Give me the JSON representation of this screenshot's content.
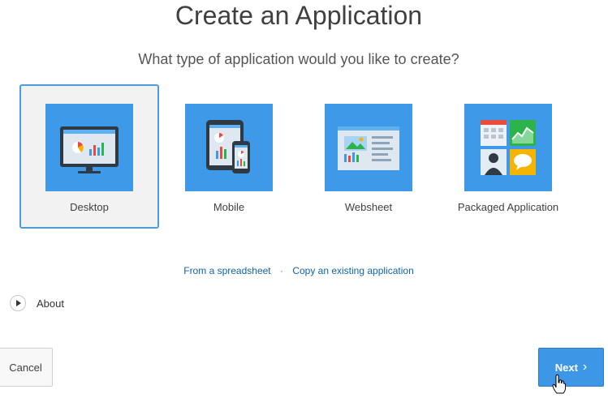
{
  "header": {
    "title": "Create an Application",
    "subtitle": "What type of application would you like to create?"
  },
  "app_types": [
    {
      "label": "Desktop",
      "icon": "desktop-icon",
      "selected": true
    },
    {
      "label": "Mobile",
      "icon": "mobile-icon",
      "selected": false
    },
    {
      "label": "Websheet",
      "icon": "websheet-icon",
      "selected": false
    },
    {
      "label": "Packaged Application",
      "icon": "packaged-application-icon",
      "selected": false
    }
  ],
  "links": {
    "spreadsheet": "From a spreadsheet",
    "separator": "·",
    "copy_existing": "Copy an existing application"
  },
  "about": {
    "label": "About",
    "icon": "play-icon"
  },
  "footer": {
    "cancel_label": "Cancel",
    "next_label": "Next",
    "next_icon": "chevron-right-icon"
  },
  "colors": {
    "tile_blue": "#3e9ae8",
    "selected_border": "#4a9de0",
    "link_blue": "#0f64a8",
    "next_button": "#3e96e6"
  }
}
